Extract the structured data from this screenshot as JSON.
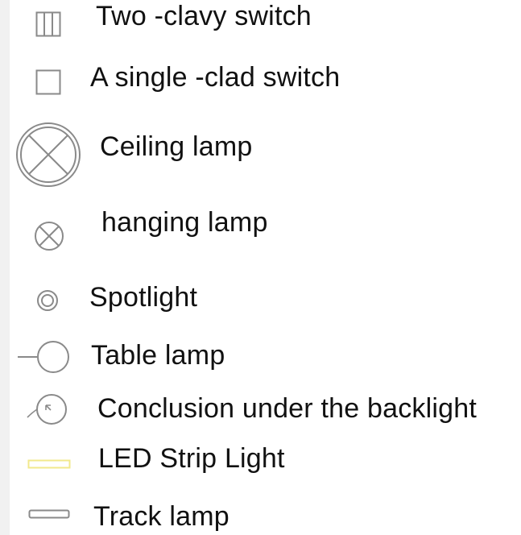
{
  "legend": {
    "items": [
      {
        "label": "Two -clavy switch",
        "icon": "double-switch-icon"
      },
      {
        "label": "A single -clad switch",
        "icon": "single-switch-icon"
      },
      {
        "label": "Ceiling lamp",
        "icon": "ceiling-lamp-icon"
      },
      {
        "label": "hanging lamp",
        "icon": "hanging-lamp-icon"
      },
      {
        "label": "Spotlight",
        "icon": "spotlight-icon"
      },
      {
        "label": "Table lamp",
        "icon": "table-lamp-icon"
      },
      {
        "label": "Conclusion under the backlight",
        "icon": "backlight-icon"
      },
      {
        "label": "LED Strip Light",
        "icon": "led-strip-icon"
      },
      {
        "label": "Track lamp",
        "icon": "track-lamp-icon"
      }
    ],
    "colors": {
      "symbol_stroke": "#8a8a8a",
      "led_strip_stroke": "#f2e98c",
      "text": "#111111",
      "side_strip": "#f1f1f1"
    }
  }
}
